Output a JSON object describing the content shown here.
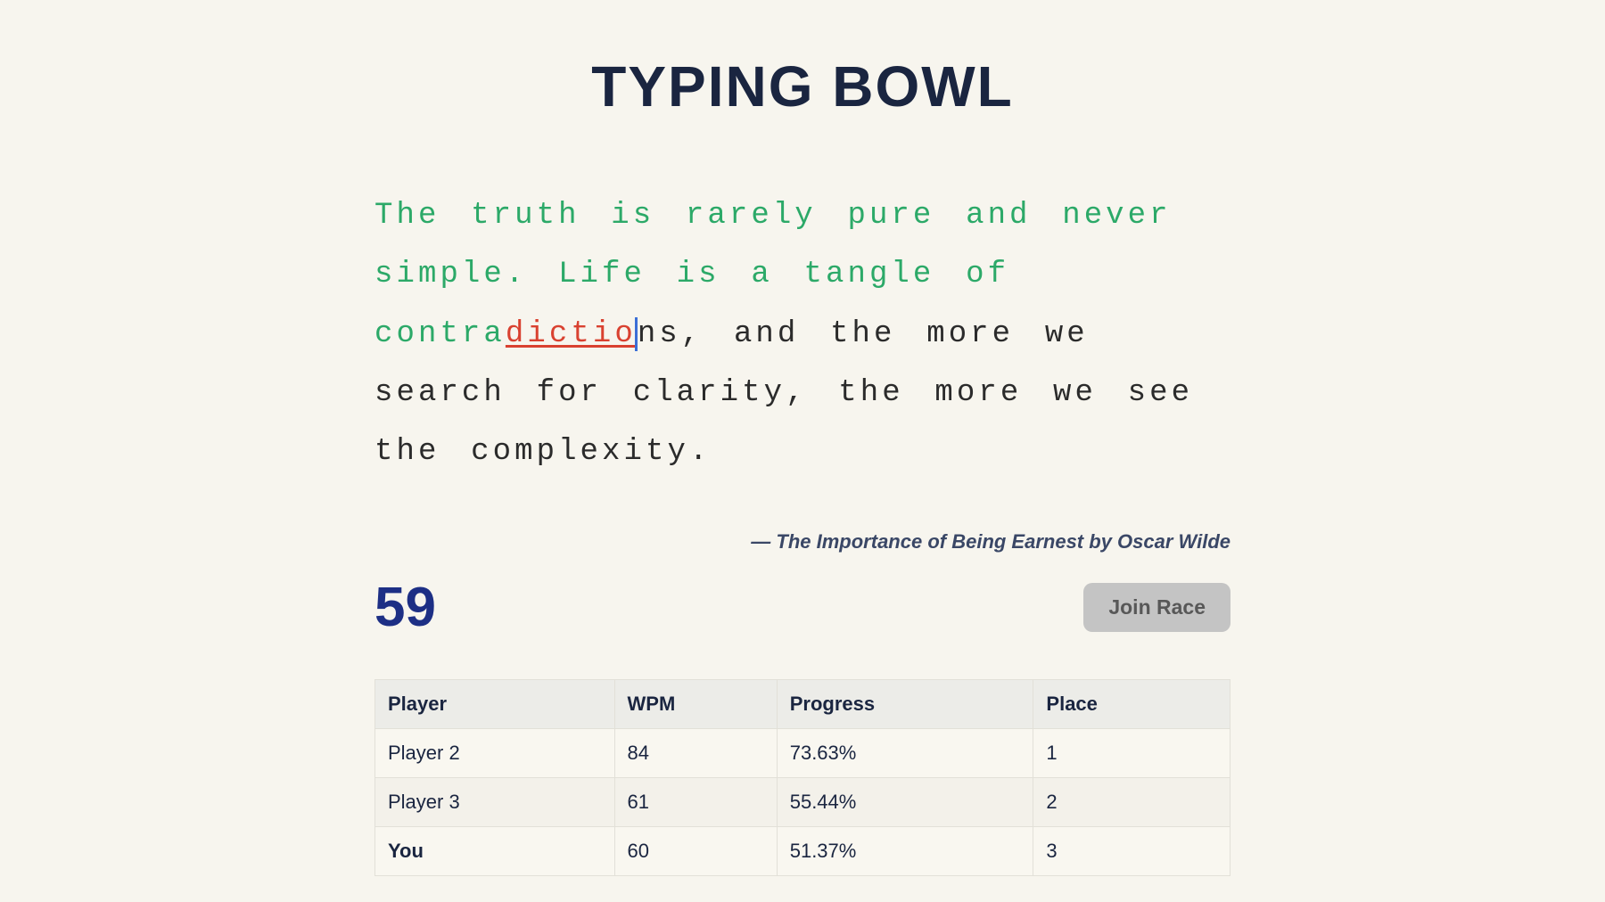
{
  "title": "TYPING BOWL",
  "passage": {
    "typed_correct": "The truth is rarely pure and never simple. Life is a tangle of contra",
    "typed_error": "dictio",
    "untyped": "ns, and the more we search for clarity, the more we see the complexity."
  },
  "attribution": "— The Importance of Being Earnest by Oscar Wilde",
  "wpm": "59",
  "join_button_label": "Join Race",
  "leaderboard": {
    "headers": {
      "player": "Player",
      "wpm": "WPM",
      "progress": "Progress",
      "place": "Place"
    },
    "rows": [
      {
        "player": "Player 2",
        "wpm": "84",
        "progress": "73.63%",
        "place": "1",
        "is_you": false
      },
      {
        "player": "Player 3",
        "wpm": "61",
        "progress": "55.44%",
        "place": "2",
        "is_you": false
      },
      {
        "player": "You",
        "wpm": "60",
        "progress": "51.37%",
        "place": "3",
        "is_you": true
      }
    ]
  }
}
